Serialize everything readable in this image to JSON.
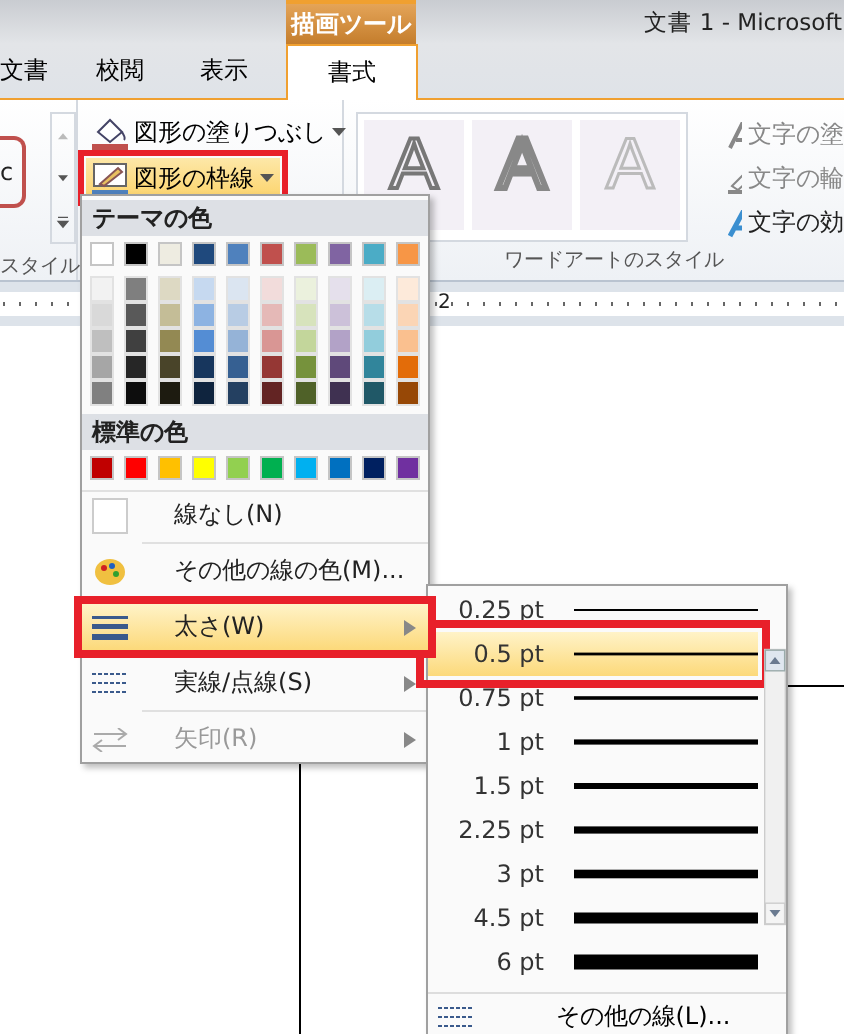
{
  "window": {
    "title": "文書 1  -  Microsoft",
    "context_tab": "描画ツール"
  },
  "tabs": [
    {
      "label": "文書",
      "selected": false
    },
    {
      "label": "校閲",
      "selected": false
    },
    {
      "label": "表示",
      "selected": false
    },
    {
      "label": "書式",
      "selected": true
    }
  ],
  "ribbon": {
    "style_preview": "c",
    "style_group_label": "スタイル",
    "commands": [
      {
        "label": "図形の塗りつぶし",
        "kind": "fill",
        "open": false,
        "outlined": false
      },
      {
        "label": "図形の枠線",
        "kind": "line",
        "open": true,
        "outlined": true
      }
    ],
    "wordart": [
      {
        "text": "A",
        "kind": "outline"
      },
      {
        "text": "A",
        "kind": "double"
      },
      {
        "text": "A",
        "kind": "soft"
      }
    ],
    "wordart_label": "ワードアートのスタイル",
    "text_commands": [
      {
        "label": "文字の塗",
        "kind": "fill",
        "disabled": true
      },
      {
        "label": "文字の輪",
        "kind": "line",
        "disabled": true
      },
      {
        "label": "文字の効",
        "kind": "effect",
        "disabled": false
      }
    ]
  },
  "ruler": {
    "label": "2"
  },
  "line_menu": {
    "theme_header": "テーマの色",
    "theme_colors": [
      {
        "color": "#ffffff",
        "shades": [
          {
            "color": "#f2f2f2"
          },
          {
            "color": "#d9d9d9"
          },
          {
            "color": "#bfbfbf"
          },
          {
            "color": "#a6a6a6"
          },
          {
            "color": "#808080"
          }
        ]
      },
      {
        "color": "#000000",
        "shades": [
          {
            "color": "#7f7f7f"
          },
          {
            "color": "#595959"
          },
          {
            "color": "#404040"
          },
          {
            "color": "#262626"
          },
          {
            "color": "#0d0d0d"
          }
        ]
      },
      {
        "color": "#eeece1",
        "shades": [
          {
            "color": "#ddd9c3"
          },
          {
            "color": "#c4bd97"
          },
          {
            "color": "#938953"
          },
          {
            "color": "#494429"
          },
          {
            "color": "#1d1b10"
          }
        ]
      },
      {
        "color": "#1f497d",
        "shades": [
          {
            "color": "#c6d9f0"
          },
          {
            "color": "#8db3e2"
          },
          {
            "color": "#548dd4"
          },
          {
            "color": "#17365d"
          },
          {
            "color": "#0f243e"
          }
        ]
      },
      {
        "color": "#4f81bd",
        "shades": [
          {
            "color": "#dbe5f1"
          },
          {
            "color": "#b8cce4"
          },
          {
            "color": "#95b3d7"
          },
          {
            "color": "#366092"
          },
          {
            "color": "#244061"
          }
        ]
      },
      {
        "color": "#c0504d",
        "shades": [
          {
            "color": "#f2dcdb"
          },
          {
            "color": "#e5b9b7"
          },
          {
            "color": "#d99694"
          },
          {
            "color": "#953734"
          },
          {
            "color": "#632423"
          }
        ]
      },
      {
        "color": "#9bbb59",
        "shades": [
          {
            "color": "#ebf1dd"
          },
          {
            "color": "#d7e3bc"
          },
          {
            "color": "#c3d69b"
          },
          {
            "color": "#76923c"
          },
          {
            "color": "#4f6128"
          }
        ]
      },
      {
        "color": "#8064a2",
        "shades": [
          {
            "color": "#e5e0ec"
          },
          {
            "color": "#ccc1d9"
          },
          {
            "color": "#b2a2c7"
          },
          {
            "color": "#5f497a"
          },
          {
            "color": "#3f3151"
          }
        ]
      },
      {
        "color": "#4bacc6",
        "shades": [
          {
            "color": "#dbeef3"
          },
          {
            "color": "#b7dde8"
          },
          {
            "color": "#92cddc"
          },
          {
            "color": "#31859b"
          },
          {
            "color": "#205867"
          }
        ]
      },
      {
        "color": "#f79646",
        "shades": [
          {
            "color": "#fdeada"
          },
          {
            "color": "#fbd5b5"
          },
          {
            "color": "#fac08f"
          },
          {
            "color": "#e36c09"
          },
          {
            "color": "#974806"
          }
        ]
      }
    ],
    "standard_header": "標準の色",
    "standard_colors": [
      {
        "color": "#c00000"
      },
      {
        "color": "#ff0000"
      },
      {
        "color": "#ffc000"
      },
      {
        "color": "#ffff00"
      },
      {
        "color": "#92d050"
      },
      {
        "color": "#00b050"
      },
      {
        "color": "#00b0f0"
      },
      {
        "color": "#0070c0"
      },
      {
        "color": "#002060"
      },
      {
        "color": "#7030a0"
      }
    ],
    "items": [
      {
        "label": "線なし(N)",
        "kind": "none",
        "selected": false,
        "disabled": false,
        "submenu": false,
        "outlined": false
      },
      {
        "label": "その他の線の色(M)...",
        "kind": "palette",
        "selected": false,
        "disabled": false,
        "submenu": false,
        "outlined": false
      },
      {
        "label": "太さ(W)",
        "kind": "weight",
        "selected": true,
        "disabled": false,
        "submenu": true,
        "outlined": true
      },
      {
        "label": "実線/点線(S)",
        "kind": "dash",
        "selected": false,
        "disabled": false,
        "submenu": true,
        "outlined": false
      },
      {
        "label": "矢印(R)",
        "kind": "arrow",
        "selected": false,
        "disabled": true,
        "submenu": true,
        "outlined": false
      }
    ]
  },
  "weight_menu": {
    "items": [
      {
        "label": "0.25 pt",
        "selected": false,
        "outlined": false
      },
      {
        "label": "0.5 pt",
        "selected": true,
        "outlined": true
      },
      {
        "label": "0.75 pt",
        "selected": false,
        "outlined": false
      },
      {
        "label": "1 pt",
        "selected": false,
        "outlined": false
      },
      {
        "label": "1.5 pt",
        "selected": false,
        "outlined": false
      },
      {
        "label": "2.25 pt",
        "selected": false,
        "outlined": false
      },
      {
        "label": "3 pt",
        "selected": false,
        "outlined": false
      },
      {
        "label": "4.5 pt",
        "selected": false,
        "outlined": false
      },
      {
        "label": "6 pt",
        "selected": false,
        "outlined": false
      }
    ],
    "footer": "その他の線(L)..."
  }
}
